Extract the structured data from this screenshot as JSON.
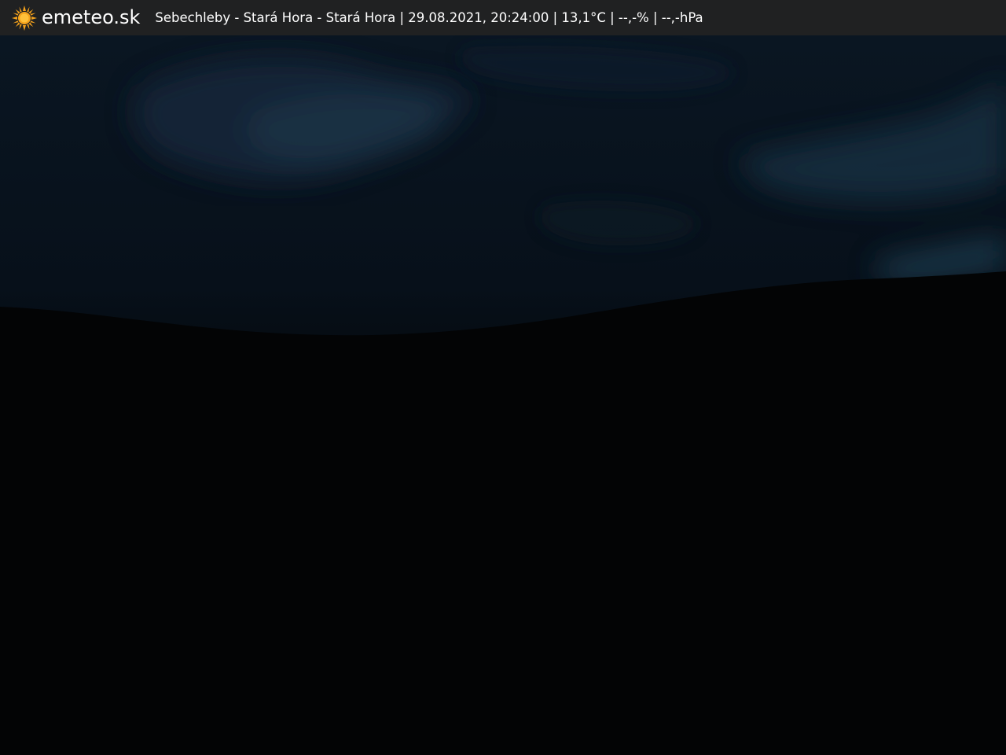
{
  "header": {
    "brand": "emeteo.sk",
    "caption": "Sebechleby - Stará Hora - Stará Hora | 29.08.2021, 20:24:00 | 13,1°C | --,-% | --,-hPa",
    "logo_icon": "sun-icon",
    "logo_color": "#f4a21c",
    "bar_color": "#202122"
  },
  "webcam": {
    "sky_color": "#07101a",
    "cloud_color": "#1b3448",
    "ground_color": "#020304"
  }
}
